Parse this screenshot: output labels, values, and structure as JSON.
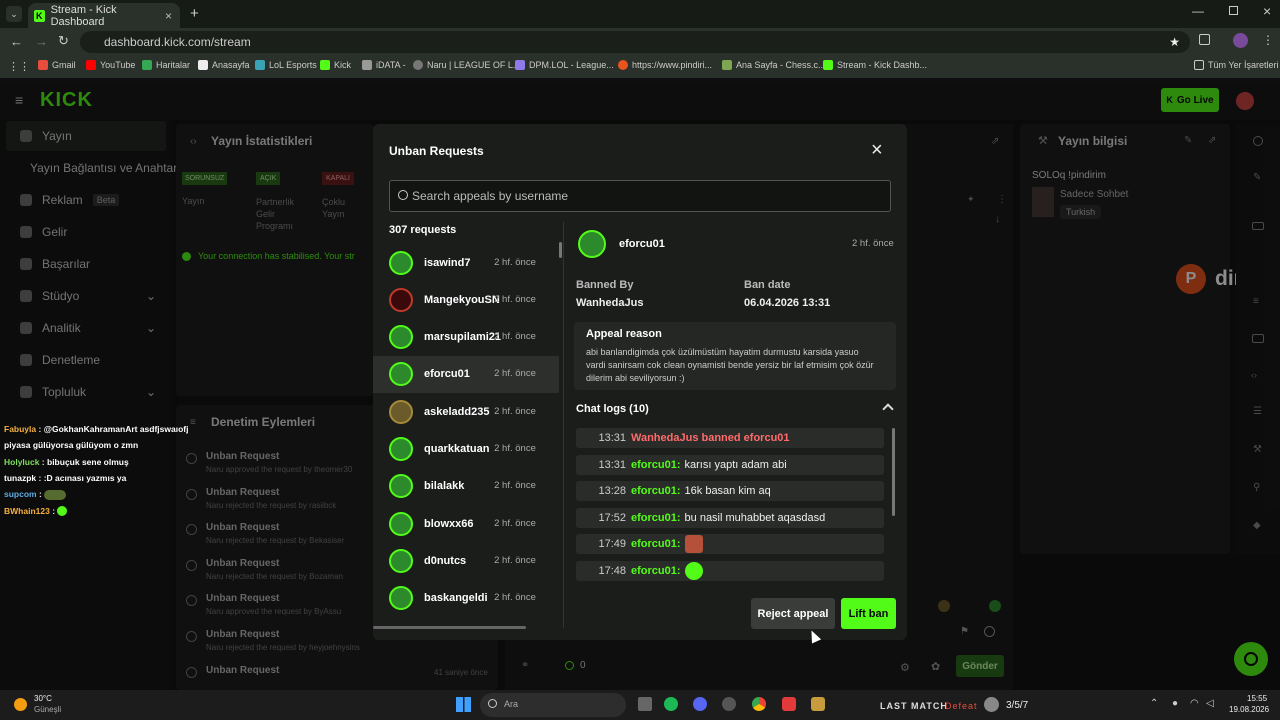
{
  "browser": {
    "tab_title": "Stream - Kick Dashboard",
    "url": "dashboard.kick.com/stream",
    "bookmarks": [
      "Gmail",
      "YouTube",
      "Haritalar",
      "Anasayfa",
      "LoL Esports",
      "Kick",
      "iDATA -",
      "Naru | LEAGUE OF L...",
      "DPM.LOL - League...",
      "https://www.pindiri...",
      "Ana Sayfa - Chess.c...",
      "Stream - Kick Dashb..."
    ],
    "all_bookmarks": "Tüm Yer İşaretleri"
  },
  "header": {
    "logo": "KICK",
    "go_live": "Go Live"
  },
  "sidebar": {
    "items": [
      {
        "label": "Yayın"
      },
      {
        "label": "Yayın Bağlantısı ve Anahtar"
      },
      {
        "label": "Reklam",
        "badge": "Beta"
      },
      {
        "label": "Gelir"
      },
      {
        "label": "Başarılar"
      },
      {
        "label": "Stüdyo"
      },
      {
        "label": "Analitik"
      },
      {
        "label": "Denetleme"
      },
      {
        "label": "Topluluk"
      }
    ]
  },
  "stats_panel": {
    "title": "Yayın İstatistikleri",
    "badges": [
      "SORUNSUZ",
      "AÇIK",
      "KAPALI"
    ],
    "labels": [
      "Yayın",
      "Partnerlik Gelir Programı",
      "Çoklu Yayın"
    ],
    "connection": "Your connection has stabilised. Your str"
  },
  "moderation_panel": {
    "title": "Denetim Eylemleri",
    "items": [
      {
        "title": "Unban Request",
        "sub": "Naru approved the request by theomer30"
      },
      {
        "title": "Unban Request",
        "sub": "Naru rejected the request by rasiibck"
      },
      {
        "title": "Unban Request",
        "sub": "Naru rejected the request by Bekasiser"
      },
      {
        "title": "Unban Request",
        "sub": "Naru rejected the request by Bozaman"
      },
      {
        "title": "Unban Request",
        "sub": "Naru approved the request by ByAssu"
      },
      {
        "title": "Unban Request",
        "sub": "Naru rejected the request by heyjoehnysins"
      },
      {
        "title": "Unban Request",
        "sub": ""
      }
    ],
    "last_time": "41 saniye önce"
  },
  "info_panel": {
    "title": "Yayın bilgisi",
    "stream_title": "SOLOq !pindirim",
    "category": "Sadece Sohbet",
    "tag": "Turkish",
    "brand": "dirim"
  },
  "chat_input": {
    "send": "Gönder",
    "count": "0"
  },
  "overlay_chat": [
    {
      "user": "Fabuyla",
      "user_color": "#f5b041",
      "text": "@GokhanKahramanArt asdfjswaıofj"
    },
    {
      "user": "",
      "user_color": "#ffffff",
      "text": "piyasa gülüyorsa gülüyom o zmn"
    },
    {
      "user": "Holyluck",
      "user_color": "#7ee05a",
      "text": "bibuçuk sene olmuş"
    },
    {
      "user": "tunazpk",
      "user_color": "#ffffff",
      "text": ":D acınası yazmıs ya"
    },
    {
      "user": "supcom",
      "user_color": "#5dade2",
      "text": ""
    },
    {
      "user": "BWhain123",
      "user_color": "#f5b041",
      "text": ""
    }
  ],
  "modal": {
    "title": "Unban Requests",
    "search_placeholder": "Search appeals by username",
    "count_label": "307 requests",
    "requests": [
      {
        "name": "isawind7",
        "time": "2 hf. önce"
      },
      {
        "name": "MangekyouSN",
        "time": "2 hf. önce"
      },
      {
        "name": "marsupilami21",
        "time": "2 hf. önce"
      },
      {
        "name": "eforcu01",
        "time": "2 hf. önce"
      },
      {
        "name": "askeladd235",
        "time": "2 hf. önce"
      },
      {
        "name": "quarkkatuan",
        "time": "2 hf. önce"
      },
      {
        "name": "bilalakk",
        "time": "2 hf. önce"
      },
      {
        "name": "blowxx66",
        "time": "2 hf. önce"
      },
      {
        "name": "d0nutcs",
        "time": "2 hf. önce"
      },
      {
        "name": "baskangeldi",
        "time": "2 hf. önce"
      }
    ],
    "selected_index": 3,
    "detail": {
      "name": "eforcu01",
      "time": "2 hf. önce",
      "banned_by_label": "Banned By",
      "banned_by": "WanhedaJus",
      "ban_date_label": "Ban date",
      "ban_date": "06.04.2026 13:31",
      "appeal_reason_label": "Appeal reason",
      "appeal_reason": "abi banlandigimda çok üzülmüstüm hayatim durmustu karsida yasuo vardi sanirsam cok clean oynamisti bende yersiz bir laf etmisim çok özür dilerim abi seviliyorsun :)",
      "chat_logs_label": "Chat logs (10)",
      "chat_logs": [
        {
          "time": "13:31",
          "name": "WanhedaJus banned eforcu01",
          "msg": "",
          "system": true
        },
        {
          "time": "13:31",
          "name": "eforcu01:",
          "msg": "karısı yaptı adam abi"
        },
        {
          "time": "13:28",
          "name": "eforcu01:",
          "msg": "16k basan kim aq"
        },
        {
          "time": "17:52",
          "name": "eforcu01:",
          "msg": "bu nasil muhabbet aqasdasd"
        },
        {
          "time": "17:49",
          "name": "eforcu01:",
          "msg": "",
          "emote": "#b5513a"
        },
        {
          "time": "17:48",
          "name": "eforcu01:",
          "msg": "",
          "emote": "#53fc18"
        }
      ]
    },
    "reject_label": "Reject appeal",
    "lift_label": "Lift ban"
  },
  "taskbar": {
    "weather_temp": "30°C",
    "weather_desc": "Güneşli",
    "search_placeholder": "Ara",
    "last_match": "LAST MATCH",
    "result": "Defeat",
    "kda": "3/5/7",
    "time": "15:55",
    "date": "19.08.2026"
  }
}
